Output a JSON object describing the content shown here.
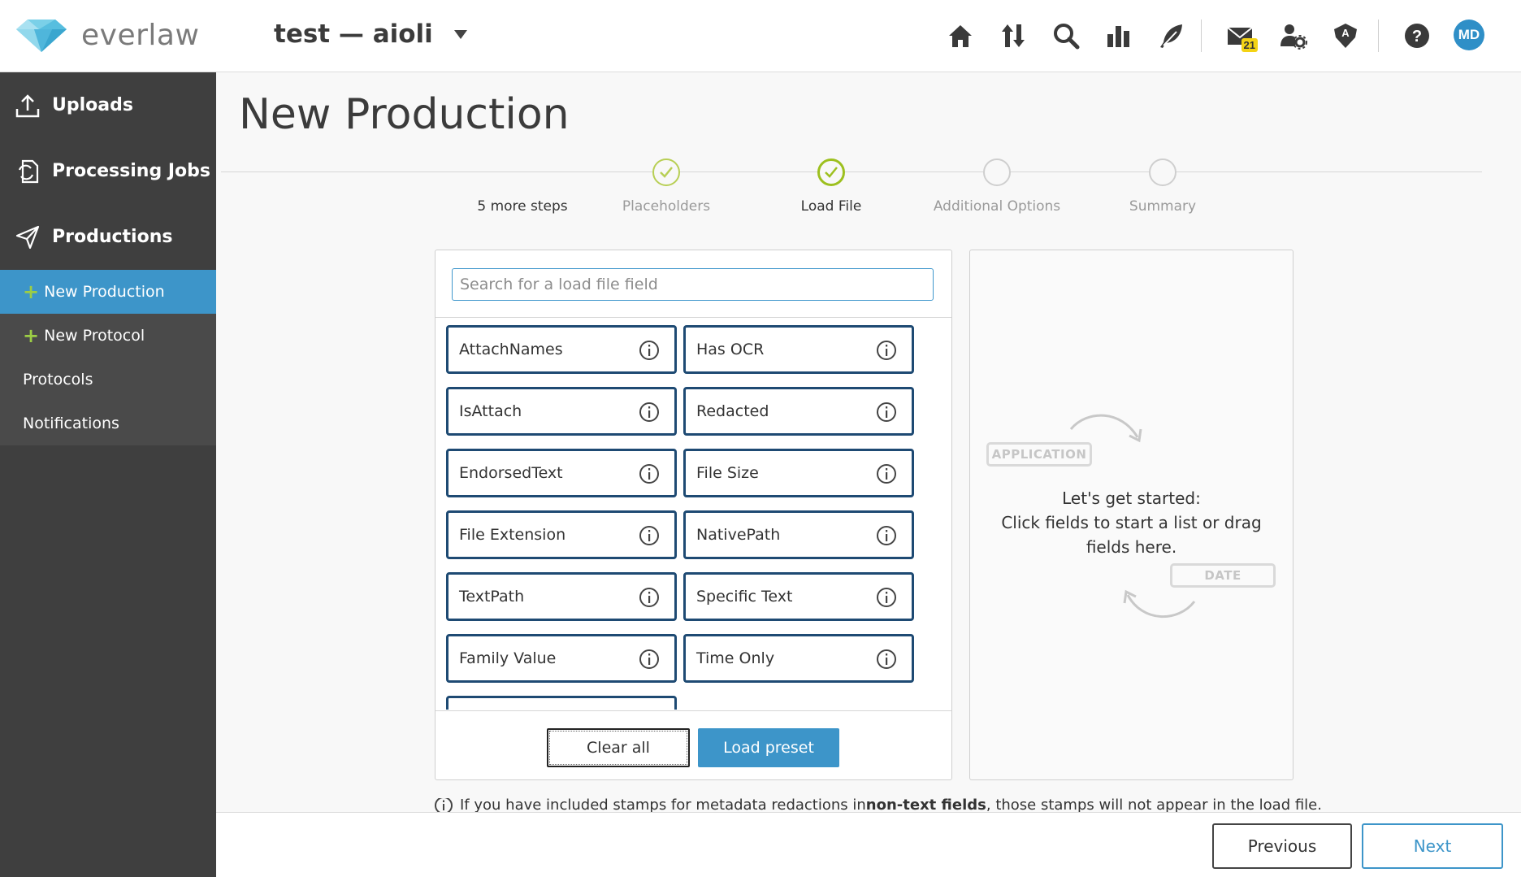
{
  "app": {
    "brand": "everlaw",
    "project": "test — aioli"
  },
  "topbar": {
    "icons": [
      "home-icon",
      "transfer-icon",
      "search-icon",
      "analytics-icon",
      "feather-icon",
      "mail-icon",
      "user-settings-icon",
      "admin-icon",
      "help-icon"
    ],
    "mail_badge": "21",
    "avatar_initials": "MD"
  },
  "sidebar": {
    "sections": [
      {
        "label": "Uploads",
        "icon": "upload-icon"
      },
      {
        "label": "Processing Jobs",
        "icon": "processing-icon"
      },
      {
        "label": "Productions",
        "icon": "send-icon"
      }
    ],
    "sub_items": [
      {
        "label": "New Production",
        "plus": true,
        "active": true
      },
      {
        "label": "New Protocol",
        "plus": true,
        "active": false
      },
      {
        "label": "Protocols",
        "plus": false,
        "active": false
      },
      {
        "label": "Notifications",
        "plus": false,
        "active": false
      }
    ]
  },
  "page": {
    "title": "New Production"
  },
  "steps": {
    "more": "5 more steps",
    "items": [
      {
        "label": "Placeholders",
        "state": "done"
      },
      {
        "label": "Load File",
        "state": "current"
      },
      {
        "label": "Additional Options",
        "state": "pending"
      },
      {
        "label": "Summary",
        "state": "pending"
      }
    ]
  },
  "fields_panel": {
    "search_placeholder": "Search for a load file field",
    "fields": [
      "AttachNames",
      "Has OCR",
      "IsAttach",
      "Redacted",
      "EndorsedText",
      "File Size",
      "File Extension",
      "NativePath",
      "TextPath",
      "Specific Text",
      "Family Value",
      "Time Only",
      ""
    ],
    "clear_label": "Clear all",
    "preset_label": "Load preset"
  },
  "drop_panel": {
    "tag_top": "APPLICATION",
    "tag_bottom": "DATE",
    "line1": "Let's get started:",
    "line2": "Click fields to start a list or drag fields here."
  },
  "notice": {
    "pre": "If you have included stamps for metadata redactions in ",
    "bold": "non-text fields",
    "post": ", those stamps will not appear in the load file."
  },
  "footer": {
    "previous": "Previous",
    "next": "Next"
  },
  "colors": {
    "accent": "#3d95c9",
    "sidebar": "#3f3f3f",
    "field_border": "#1e4a73",
    "step_done": "#9dc01f",
    "badge": "#f4d314"
  }
}
